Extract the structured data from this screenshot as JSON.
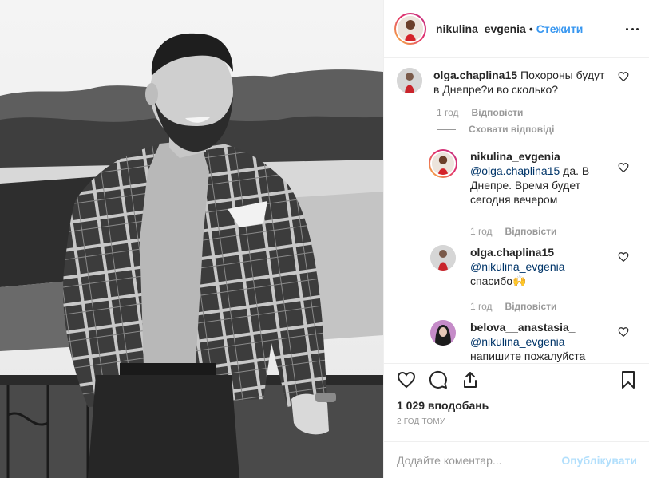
{
  "post": {
    "author": "nikulina_evgenia",
    "separator": "•",
    "follow_label": "Стежити",
    "more_icon": "more-options-icon"
  },
  "comments": [
    {
      "user": "olga.chaplina15",
      "text": "Похороны будут в Днепре?и во сколько?",
      "time": "1 год",
      "reply_label": "Відповісти"
    }
  ],
  "hide_replies_label": "Сховати відповіді",
  "replies": [
    {
      "user": "nikulina_evgenia",
      "mention": "@olga.chaplina15",
      "text": " да. В Днепре. Время будет сегодня вечером",
      "time": "1 год",
      "reply_label": "Відповісти"
    },
    {
      "user": "olga.chaplina15",
      "mention": "@nikulina_evgenia",
      "text": " спасибо🙌",
      "time": "1 год",
      "reply_label": "Відповісти"
    },
    {
      "user": "belova__anastasia_",
      "mention": "@nikulina_evgenia",
      "text": " напишите пожалуйста",
      "time": "",
      "reply_label": ""
    }
  ],
  "actions": {
    "like_icon": "heart-icon",
    "comment_icon": "comment-icon",
    "share_icon": "share-icon",
    "save_icon": "bookmark-icon",
    "likes_text": "1 029 вподобань",
    "time_ago": "2 ГОД ТОМУ"
  },
  "add_comment": {
    "placeholder": "Додайте коментар...",
    "publish_label": "Опублікувати"
  },
  "colors": {
    "link": "#3897f0",
    "mention": "#003569",
    "muted": "#999999",
    "publish_disabled": "#b2dffc"
  }
}
